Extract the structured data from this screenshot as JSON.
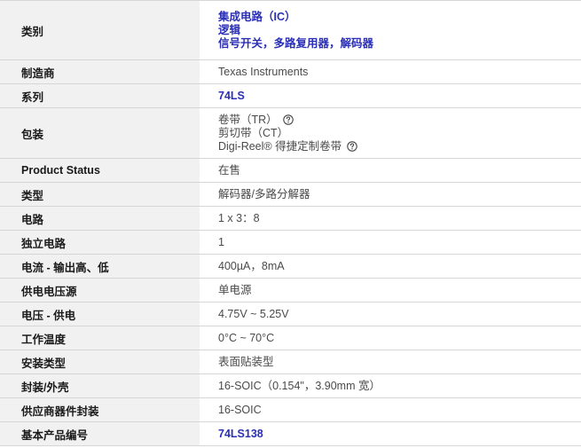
{
  "rows": [
    {
      "key": "category",
      "label": "类别",
      "values": [
        "集成电路（IC）",
        "逻辑",
        "信号开关，多路复用器，解码器"
      ]
    },
    {
      "key": "manufacturer",
      "label": "制造商",
      "value": "Texas Instruments"
    },
    {
      "key": "series",
      "label": "系列",
      "value": "74LS"
    },
    {
      "key": "packaging",
      "label": "包装",
      "values": [
        "卷带（TR）",
        "剪切带（CT）",
        "Digi-Reel® 得捷定制卷带"
      ]
    },
    {
      "key": "product_status",
      "label": "Product Status",
      "value": "在售"
    },
    {
      "key": "type",
      "label": "类型",
      "value": "解码器/多路分解器"
    },
    {
      "key": "circuit",
      "label": "电路",
      "value": "1 x 3：8"
    },
    {
      "key": "independent_circuits",
      "label": "独立电路",
      "value": "1"
    },
    {
      "key": "current_output",
      "label": "电流 - 输出高、低",
      "value": "400µA，8mA"
    },
    {
      "key": "voltage_source",
      "label": "供电电压源",
      "value": "单电源"
    },
    {
      "key": "voltage_supply",
      "label": "电压 - 供电",
      "value": "4.75V ~ 5.25V"
    },
    {
      "key": "operating_temp",
      "label": "工作温度",
      "value": "0°C ~ 70°C"
    },
    {
      "key": "mounting_type",
      "label": "安装类型",
      "value": "表面贴装型"
    },
    {
      "key": "package_case",
      "label": "封装/外壳",
      "value": "16-SOIC（0.154\"，3.90mm 宽）"
    },
    {
      "key": "supplier_package",
      "label": "供应商器件封装",
      "value": "16-SOIC"
    },
    {
      "key": "base_part_number",
      "label": "基本产品编号",
      "value": "74LS138"
    }
  ],
  "icons": {
    "help": "question-circle-icon"
  },
  "colors": {
    "link": "#2a2fb5",
    "label_bg": "#f1f1f1",
    "border": "#d6d6d6",
    "text": "#4a4a4a"
  }
}
